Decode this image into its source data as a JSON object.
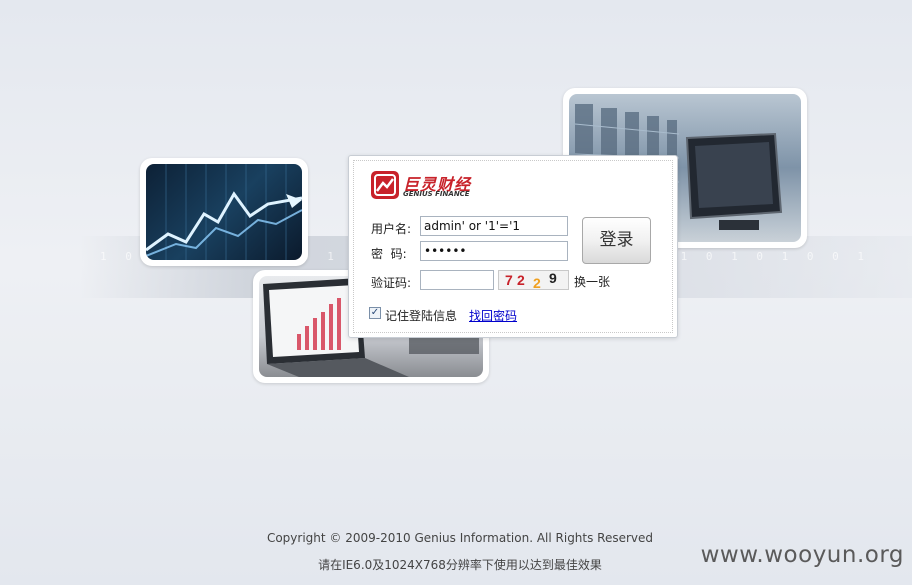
{
  "logo": {
    "brand_cn": "巨灵财经",
    "brand_en": "GENIUS FINANCE"
  },
  "login": {
    "username_label": "用户名:",
    "username_value": "admin' or '1'='1",
    "password_label": "密  码:",
    "password_value": "••••••",
    "captcha_label": "验证码:",
    "captcha_value": "",
    "captcha_digits": [
      "7",
      "2",
      "2",
      "9"
    ],
    "captcha_colors": [
      "#c8222a",
      "#c8222a",
      "#f0a020",
      "#222222"
    ],
    "refresh_label": "换一张",
    "submit_label": "登录",
    "remember_label": "记住登陆信息",
    "remember_checked": true,
    "forgot_label": "找回密码"
  },
  "footer": {
    "copyright": "Copyright © 2009-2010 Genius Information. All Rights Reserved",
    "resolution_note": "请在IE6.0及1024X768分辨率下使用以达到最佳效果"
  },
  "watermark": "www.wooyun.org",
  "colors": {
    "brand_red": "#c8222a",
    "link_blue": "#0000cc"
  }
}
